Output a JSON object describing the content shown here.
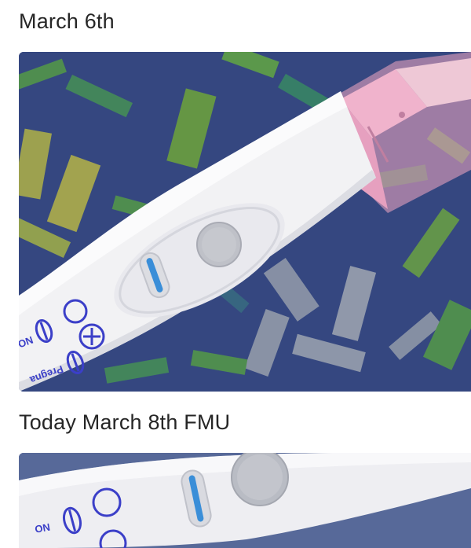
{
  "post": {
    "captions": [
      "March 6th",
      "Today March 8th FMU"
    ],
    "photos": [
      {
        "subject": "pregnancy test stick"
      },
      {
        "subject": "pregnancy test stick"
      }
    ]
  },
  "test_device": {
    "legend_label_top": "NO",
    "legend_label_bottom": "Pregna"
  },
  "colors": {
    "fabric_base": "#3b4f8c",
    "fabric_green": "#5fae4a",
    "fabric_yellow": "#c9c94a",
    "fabric_grey": "#9aa6b6",
    "stick_body": "#f2f2f4",
    "cap_pink": "#e8a8c4",
    "result_line": "#3a8ed8",
    "legend_blue": "#3b3fc8"
  }
}
